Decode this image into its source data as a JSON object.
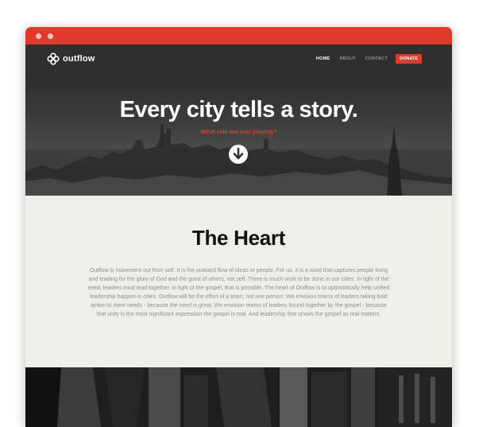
{
  "nav": {
    "logo_text": "outflow",
    "items": [
      {
        "label": "HOME",
        "active": true
      },
      {
        "label": "ABOUT",
        "active": false
      },
      {
        "label": "CONTACT",
        "active": false
      }
    ],
    "donate_label": "DONATE"
  },
  "hero": {
    "title": "Every city tells a story.",
    "subtitle": "What role are you playing?",
    "arrow_icon": "arrow-down-circle"
  },
  "section": {
    "title": "The Heart",
    "body": "Outflow is movement out from self. It is the outward flow of ideas or people. For us, it is a word that captures people living and leading for the glory of God and the good of others, not self. There is much work to be done in our cities. In light of the need, leaders must lead together. In light of the gospel, that is possible. The heart of Outflow is to optimistically help unified leadership happen in cities. Outflow will be the effort of a team, not one person. We envision teams of leaders taking bold action to meet needs - because the need is great. We envision teams of leaders bound together by the gospel - because that unity is the most significant expression the gospel is real. And leadership that shows the gospel as real matters."
  },
  "colors": {
    "accent": "#e03a2c",
    "nav_bg": "#2f2f2f",
    "content_bg": "#efefe9"
  }
}
